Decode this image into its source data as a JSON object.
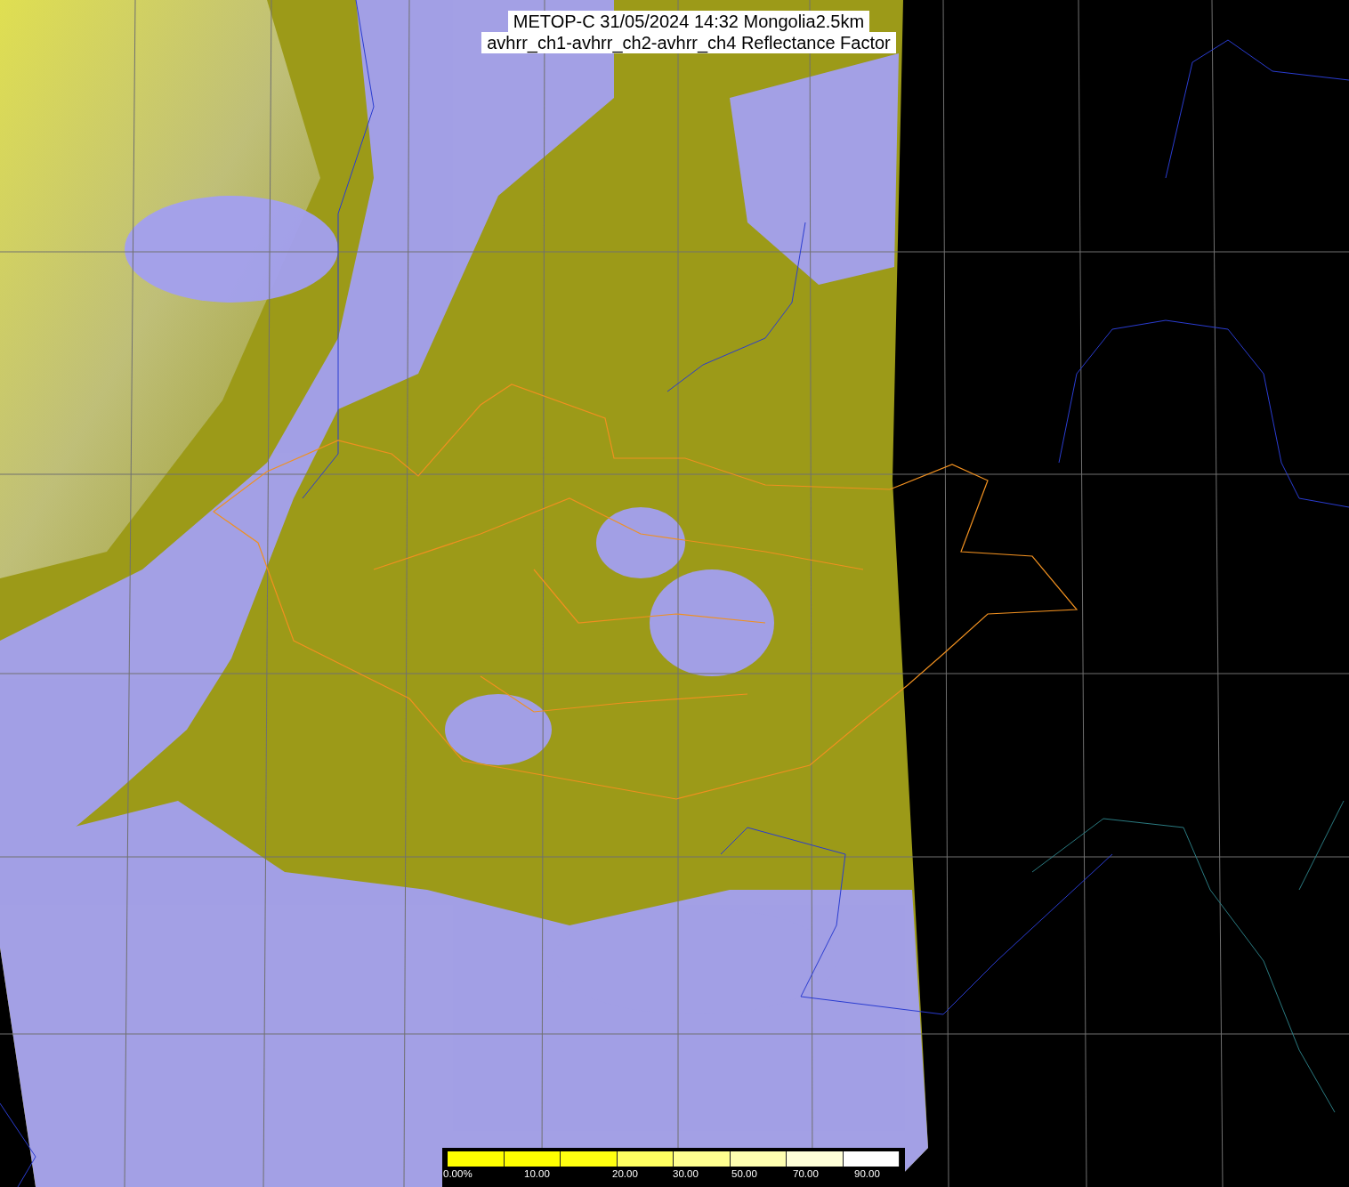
{
  "title": {
    "lines": [
      "METOP-C 31/05/2024 14:32 Mongolia2.5km",
      "avhrr_ch1-avhrr_ch2-avhrr_ch4 Reflectance Factor"
    ]
  },
  "colorbar": {
    "labels": [
      "0.00%",
      "10.00",
      "20.00",
      "30.00",
      "50.00",
      "70.00",
      "90.00"
    ]
  }
}
